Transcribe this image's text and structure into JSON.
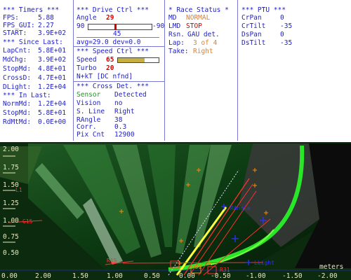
{
  "timers": {
    "header": "*** Timers ***",
    "rows": [
      {
        "label": "FPS:",
        "value": "5.88"
      },
      {
        "label": "FPS_GUI:",
        "value": "2.27"
      },
      {
        "label": "START:",
        "value": "3.9E+02"
      }
    ],
    "since_header": "*** Since Last:",
    "since_rows": [
      {
        "label": "LapCnt:",
        "value": "5.8E+01"
      },
      {
        "label": "MdChg:",
        "value": "3.9E+02"
      },
      {
        "label": "StopMd:",
        "value": "4.8E+01"
      },
      {
        "label": "CrossD:",
        "value": "4.7E+01"
      },
      {
        "label": "DLight:",
        "value": "1.2E+04"
      }
    ],
    "in_header": "*** In Last:",
    "in_rows": [
      {
        "label": "NormMd:",
        "value": "1.2E+04"
      },
      {
        "label": "StopMd:",
        "value": "5.8E+01"
      },
      {
        "label": "RdMtMd:",
        "value": "0.0E+00"
      }
    ]
  },
  "drive": {
    "header": "*** Drive Ctrl ***",
    "angle_label": "Angle",
    "angle_value": "29",
    "slider_left": "90",
    "slider_right": "-90",
    "slider_level": 0.42,
    "slider_mid": "45",
    "avg_line": "avg=29.0 dev=0.0",
    "speed_header": "*** Speed Ctrl ***",
    "speed_label": "Speed",
    "speed_value": "65",
    "speed_level": 0.65,
    "turbo_label": "Turbo",
    "turbo_value": "20",
    "nkt_line": "N+kT [DC nfnd]",
    "cross_header": "*** Cross Det. ***",
    "cross_rows": [
      {
        "label": "Sensor",
        "value": "Detected"
      },
      {
        "label": "Vision",
        "value": "no"
      },
      {
        "label": "S. Line",
        "value": "Right"
      },
      {
        "label": "RAngle",
        "value": "38"
      },
      {
        "label": "Corr.",
        "value": "0.3"
      },
      {
        "label": "Pix Cnt",
        "value": "12900"
      }
    ]
  },
  "race": {
    "header": "* Race Status *",
    "rows": [
      {
        "label": "MD",
        "value": "NORMAL"
      },
      {
        "label": "LMD",
        "value": "STOP"
      },
      {
        "label": "Rsn.",
        "value": "GAU det."
      },
      {
        "label": "Lap:",
        "value": "3 of 4"
      },
      {
        "label": "Take:",
        "value": "Right"
      }
    ]
  },
  "ptu": {
    "header": "*** PTU ***",
    "rows": [
      {
        "label": "CrPan",
        "value": "0"
      },
      {
        "label": "CrTilt",
        "value": "-35"
      },
      {
        "label": "DsPan",
        "value": "0"
      },
      {
        "label": "DsTilt",
        "value": "-35"
      }
    ]
  },
  "overlay": {
    "y_ticks": [
      "1.75",
      "1.50",
      "1.25",
      "1.00",
      "0.75",
      "0.50"
    ],
    "y_tick_extra": [
      "2.00"
    ],
    "x_ticks": [
      "2.00",
      "1.50",
      "1.00",
      "0.50",
      "0.00",
      "-0.50",
      "-1.00",
      "-1.50",
      "-2.00"
    ],
    "x_first": "0.00",
    "unit": "meters",
    "labels": {
      "rangle": "RAngle",
      "l1": "L1",
      "g15": "G15",
      "r15": "R15",
      "d2": "D2",
      "r31": "R31",
      "llight": "LLight"
    },
    "colors": {
      "green_edge": "#29e629",
      "yellow": "#ffff40",
      "red": "#ff3030",
      "orange": "#ff8800",
      "blue": "#3030ff"
    }
  }
}
